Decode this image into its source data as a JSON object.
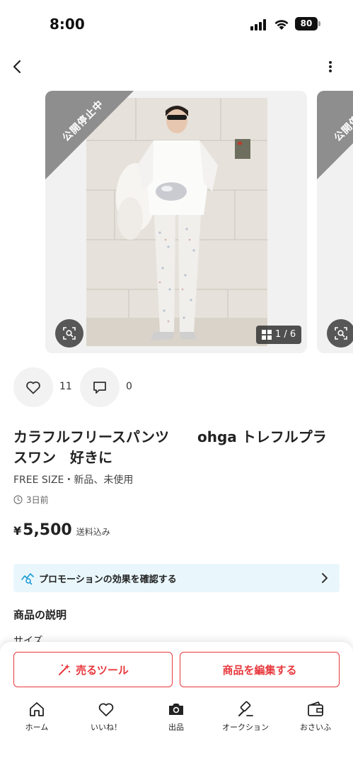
{
  "status_bar": {
    "time": "8:00",
    "battery": "80"
  },
  "carousel": {
    "ribbon_text": "公開停止中",
    "counter": "1 / 6"
  },
  "actions": {
    "likes": "11",
    "comments": "0"
  },
  "item": {
    "title": "カラフルフリースパンツ　　ohga トレフルプラスワン　好きに",
    "subtitle": "FREE SIZE・新品、未使用",
    "posted": "3日前",
    "price_symbol": "¥",
    "price": "5,500",
    "price_note": "送料込み"
  },
  "promo": {
    "label": "プロモーションの効果を確認する"
  },
  "description": {
    "heading": "商品の説明",
    "peek": "サイズ"
  },
  "buttons": {
    "sell_tools": "売るツール",
    "edit_item": "商品を編集する"
  },
  "tabs": [
    {
      "label": "ホーム",
      "icon": "home-icon"
    },
    {
      "label": "いいね！",
      "icon": "heart-icon"
    },
    {
      "label": "出品",
      "icon": "camera-icon"
    },
    {
      "label": "オークション",
      "icon": "gavel-icon"
    },
    {
      "label": "おさいふ",
      "icon": "wallet-icon"
    }
  ],
  "colors": {
    "accent": "#e8383d",
    "promo_bg": "#e9f7fd",
    "ribbon": "#8e8e8e"
  }
}
